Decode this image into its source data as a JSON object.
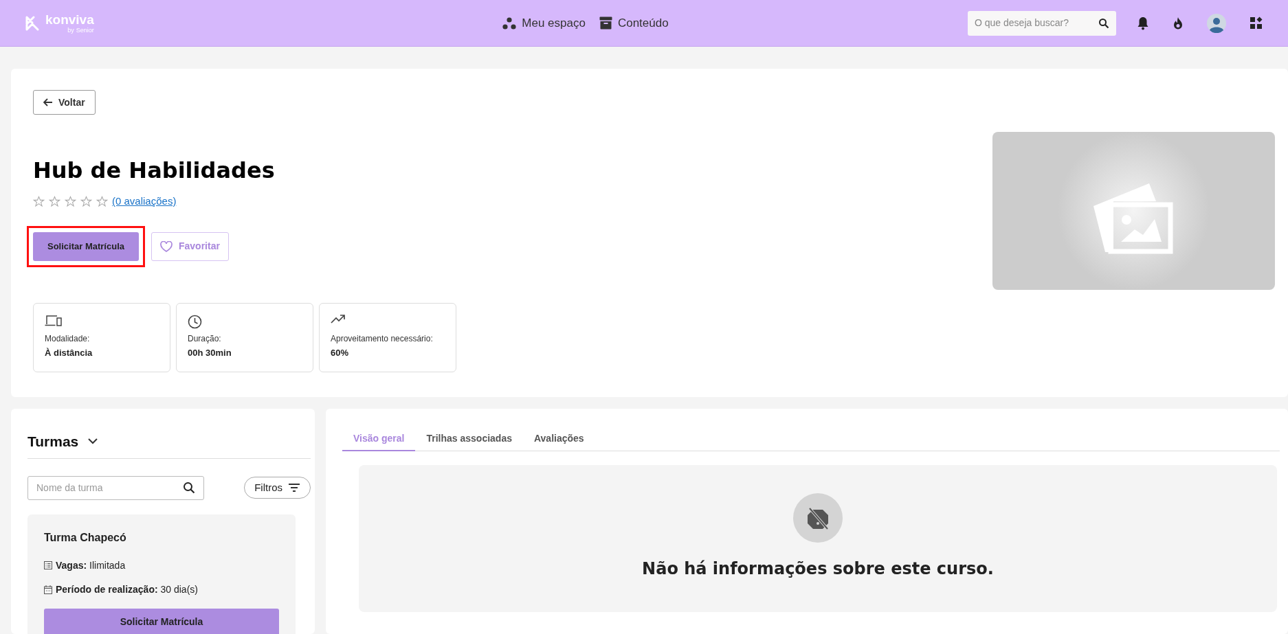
{
  "header": {
    "logo": {
      "name": "konviva",
      "byline": "by",
      "brand": "Senior"
    },
    "nav": [
      {
        "kind": "people",
        "label": "Meu espaço"
      },
      {
        "kind": "archive",
        "label": "Conteúdo"
      }
    ],
    "search": {
      "placeholder": "O que deseja buscar?"
    }
  },
  "back_button": "Voltar",
  "course": {
    "title": "Hub de Habilidades",
    "stars": 0,
    "rating_link": "(0 avaliações)",
    "primary_button": "Solicitar Matrícula",
    "favorite_button": "Favoritar",
    "info": [
      {
        "kind": "devices",
        "label": "Modalidade:",
        "value": "À distância"
      },
      {
        "kind": "clock",
        "label": "Duração:",
        "value": "00h 30min"
      },
      {
        "kind": "trend",
        "label": "Aproveitamento necessário:",
        "value": "60%"
      }
    ]
  },
  "classes": {
    "title": "Turmas",
    "search_placeholder": "Nome da turma",
    "filter_button": "Filtros",
    "items": [
      {
        "name": "Turma Chapecó",
        "vacancies_label": "Vagas:",
        "vacancies": "Ilimitada",
        "period_label": "Período de realização:",
        "period": "30 dia(s)",
        "button": "Solicitar Matrícula"
      }
    ]
  },
  "tabs": [
    {
      "label": "Visão geral",
      "selected": true
    },
    {
      "label": "Trilhas associadas",
      "selected": false
    },
    {
      "label": "Avaliações",
      "selected": false
    }
  ],
  "empty_message": "Não há informações sobre este curso."
}
